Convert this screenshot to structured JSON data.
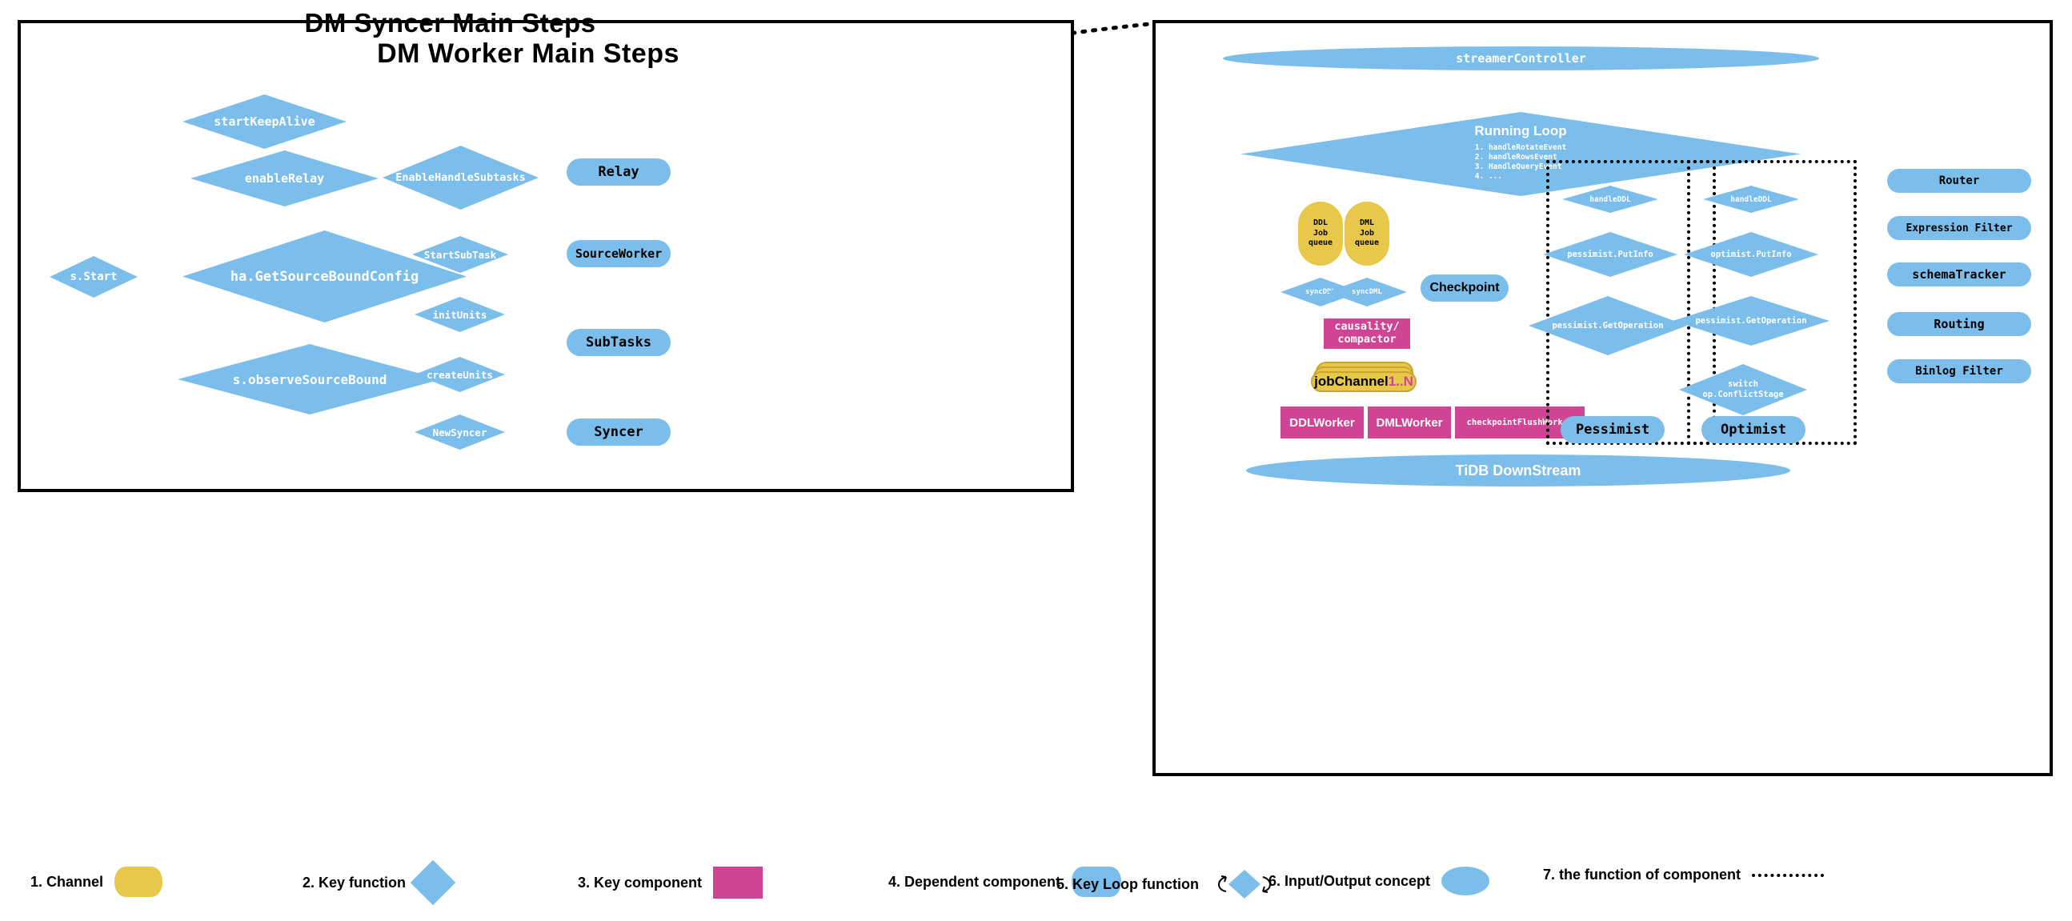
{
  "worker_panel": {
    "title": "DM Worker Main Steps",
    "nodes": {
      "start": "s.Start",
      "start_keep_alive": "startKeepAlive",
      "enable_relay": "enableRelay",
      "get_source_bound_config": "ha.GetSourceBoundConfig",
      "observe_source_bound": "s.observeSourceBound",
      "enable_handle_subtasks": "EnableHandleSubtasks",
      "start_sub_task": "StartSubTask",
      "init_units": "initUnits",
      "create_units": "createUnits",
      "new_syncer": "NewSyncer"
    },
    "components": {
      "relay": "Relay",
      "source_worker": "SourceWorker",
      "sub_tasks": "SubTasks",
      "syncer": "Syncer"
    }
  },
  "syncer_panel": {
    "title": "DM Syncer Main Steps",
    "streamer_controller": "streamerController",
    "running_loop": {
      "title": "Running Loop",
      "items": [
        "1.  handleRotateEvent",
        "2.  handleRowsEvent",
        "3.  HandleQueryEvent",
        "4.  ..."
      ]
    },
    "queues": {
      "ddl": "DDL\nJob\nqueue",
      "ddl_lines": [
        "DDL",
        "Job",
        "queue"
      ],
      "dml_lines": [
        "DML",
        "Job",
        "queue"
      ]
    },
    "sync_ddl": "syncDDL",
    "sync_dml": "syncDML",
    "checkpoint": "Checkpoint",
    "causality": "causality/\ncompactor",
    "causality_line1": "causality/",
    "causality_line2": "compactor",
    "job_channel": "jobChannel ",
    "job_channel_n": "1..N",
    "workers": {
      "ddl_worker": "DDLWorker",
      "dml_worker": "DMLWorker",
      "checkpoint_flush_worker": "checkpointFlushWorker"
    },
    "downstream": "TiDB DownStream",
    "pessimist": {
      "label": "Pessimist",
      "steps": [
        "handleDDL",
        "pessimist.PutInfo",
        "pessimist.GetOperation"
      ]
    },
    "optimist": {
      "label": "Optimist",
      "steps": [
        "handleDDL",
        "optimist.PutInfo",
        "pessimist.GetOperation"
      ],
      "switch_line1": "switch",
      "switch_line2": "op.ConflictStage"
    },
    "side_components": [
      "Router",
      "Expression Filter",
      "schemaTracker",
      "Routing",
      "Binlog Filter"
    ]
  },
  "legend": {
    "items": [
      {
        "label": "1. Channel",
        "swatch": "channel-swatch"
      },
      {
        "label": "2. Key function",
        "swatch": "diamond-swatch"
      },
      {
        "label": "3. Key component",
        "swatch": "pink-rect-swatch"
      },
      {
        "label": "4. Dependent component",
        "swatch": "pill-swatch"
      },
      {
        "label": "5. Key Loop function",
        "swatch": "loop-diamond-swatch"
      },
      {
        "label": "6. Input/Output concept",
        "swatch": "ellipse-swatch"
      },
      {
        "label": "7.  the function of component",
        "swatch": "dotted-line-swatch"
      }
    ]
  },
  "colors": {
    "blue": "#7bbeeb",
    "yellow": "#e8c84a",
    "pink": "#cf4593",
    "black": "#000000"
  }
}
